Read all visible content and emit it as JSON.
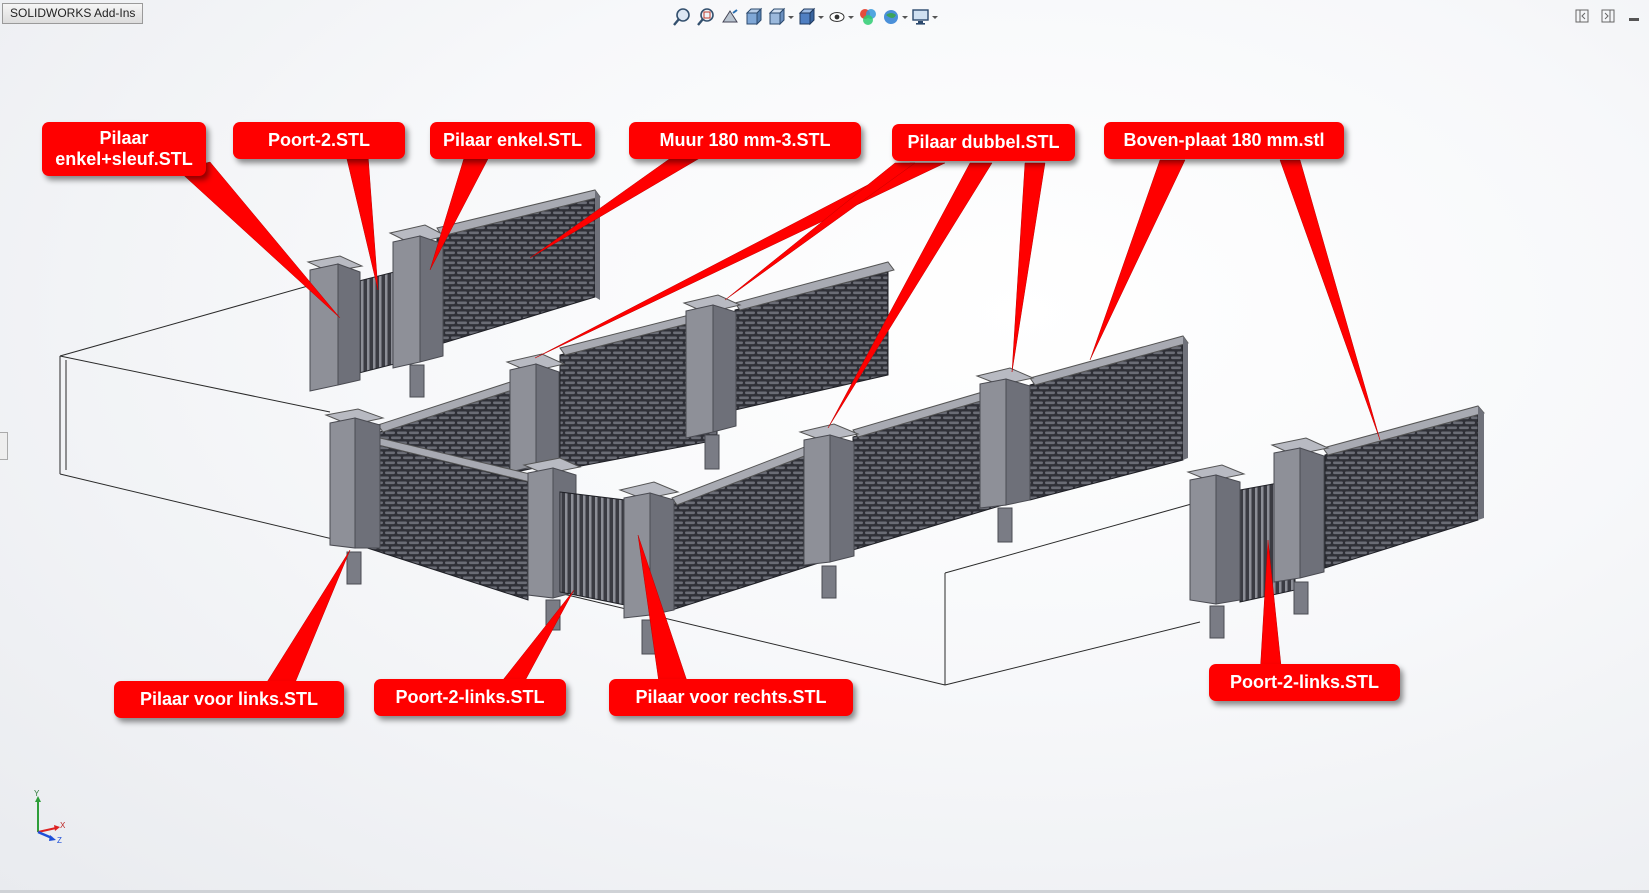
{
  "window": {
    "tab_label": "SOLIDWORKS Add-Ins"
  },
  "headsup_toolbar": {
    "icons": [
      "zoom-to-fit-icon",
      "zoom-to-area-icon",
      "previous-view-icon",
      "section-view-icon",
      "view-orientation-icon",
      "display-style-icon",
      "hide-show-items-icon",
      "edit-appearance-icon",
      "apply-scene-icon",
      "view-settings-icon"
    ]
  },
  "window_controls": {
    "icons": [
      "tile-left-icon",
      "tile-right-icon",
      "minimize-icon"
    ]
  },
  "callouts": {
    "pilaar_enkel_sleuf": "Pilaar\nenkel+sleuf.STL",
    "poort_2": "Poort-2.STL",
    "pilaar_enkel": "Pilaar enkel.STL",
    "muur_180": "Muur 180 mm-3.STL",
    "pilaar_dubbel": "Pilaar dubbel.STL",
    "boven_plaat": "Boven-plaat 180 mm.stl",
    "pilaar_voor_links": "Pilaar voor links.STL",
    "poort_2_links_a": "Poort-2-links.STL",
    "pilaar_voor_rechts": "Pilaar voor rechts.STL",
    "poort_2_links_b": "Poort-2-links.STL"
  },
  "triad": {
    "y": "Y",
    "x": "X",
    "z": "Z"
  },
  "colors": {
    "callout": "#ff0000",
    "model_gray": "#8e9098",
    "wall_dark": "#2e2f36"
  }
}
